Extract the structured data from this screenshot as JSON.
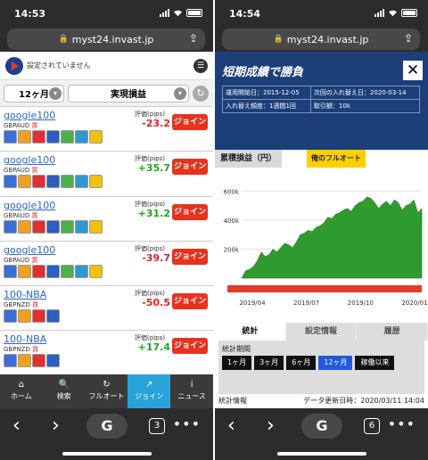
{
  "left": {
    "status": {
      "time": "14:53"
    },
    "url": "myst24.invast.jp",
    "header": {
      "settings_text": "設定されていません"
    },
    "filters": {
      "period": "12ヶ月",
      "metric": "実現損益"
    },
    "eval_label": "評価(pips)",
    "join_label": "ジョイン",
    "strategies": [
      {
        "name": "google100",
        "pair": "GBPAUD",
        "side": "買",
        "value": "-23.2",
        "color": "#e32222"
      },
      {
        "name": "google100",
        "pair": "GBPAUD",
        "side": "買",
        "value": "+35.7",
        "color": "#1ea51e"
      },
      {
        "name": "google100",
        "pair": "GBPAUD",
        "side": "買",
        "value": "+31.2",
        "color": "#1ea51e"
      },
      {
        "name": "google100",
        "pair": "GBPAUD",
        "side": "買",
        "value": "-39.7",
        "color": "#e32222"
      },
      {
        "name": "100-NBA",
        "pair": "GBPNZD",
        "side": "買",
        "value": "-50.5",
        "color": "#e32222"
      },
      {
        "name": "100-NBA",
        "pair": "GBPNZD",
        "side": "買",
        "value": "+17.4",
        "color": "#1ea51e"
      }
    ],
    "tabbar": [
      {
        "label": "ホーム",
        "icon": "home-icon",
        "glyph": "⌂"
      },
      {
        "label": "検索",
        "icon": "search-icon",
        "glyph": "🔍"
      },
      {
        "label": "フルオート",
        "icon": "refresh-icon",
        "glyph": "↻"
      },
      {
        "label": "ジョイン",
        "icon": "join-icon",
        "glyph": "↗"
      },
      {
        "label": "ニュース",
        "icon": "info-icon",
        "glyph": "i"
      }
    ],
    "bottom": {
      "tabs_count": "3"
    }
  },
  "right": {
    "status": {
      "time": "14:54"
    },
    "url": "myst24.invast.jp",
    "title": "短期成績で勝負",
    "info": {
      "start_label": "運用開始日：",
      "start_value": "2015-12-05",
      "next_label": "次回の入れ替え日：",
      "next_value": "2020-03-14",
      "freq_label": "入れ替え頻度：",
      "freq_value": "1週間1回",
      "qty_label": "取引額：",
      "qty_value": "10k"
    },
    "chart_label": "累積損益（円）",
    "badge": "俺のフルオート",
    "chart_data": {
      "type": "area",
      "title": "累積損益（円）",
      "y_ticks": [
        "200k",
        "400k",
        "600k"
      ],
      "x_ticks": [
        "2019/04",
        "2019/07",
        "2019/10",
        "2020/01"
      ],
      "ylim": [
        0,
        700
      ],
      "values": [
        0,
        50,
        60,
        80,
        120,
        180,
        150,
        160,
        200,
        180,
        210,
        240,
        230,
        210,
        250,
        300,
        310,
        330,
        320,
        350,
        360,
        380,
        420,
        410,
        440,
        450,
        470,
        480,
        460,
        500,
        520,
        530,
        560,
        550,
        520,
        480,
        510,
        530,
        500,
        540,
        520,
        470,
        500,
        510,
        540,
        450,
        480
      ]
    },
    "tabs": [
      "統計",
      "設定情報",
      "履歴"
    ],
    "period_label": "統計期間",
    "period_buttons": [
      "1ヶ月",
      "3ヶ月",
      "6ヶ月",
      "12ヶ月",
      "稼働以来"
    ],
    "stats_label": "統計情報",
    "updated": "データ更新日時：2020/03/11 14:04",
    "bottom": {
      "tabs_count": "6"
    }
  }
}
